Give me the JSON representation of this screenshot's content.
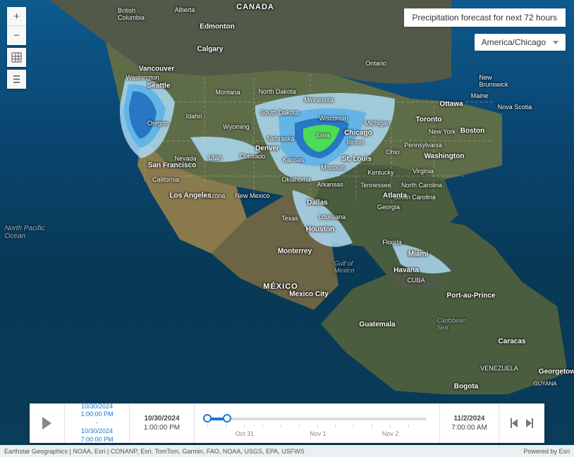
{
  "info_box": "Precipitation forecast for next 72 hours",
  "timezone": "America/Chicago",
  "toolbar": {
    "zoom_in": "+",
    "zoom_out": "−"
  },
  "water_labels": {
    "pacific": "North Pacific\nOcean",
    "gulf": "Gulf of\nMexico",
    "carib": "Caribbean\nSea"
  },
  "countries": {
    "canada": "CANADA",
    "mexico": "MÉXICO",
    "cuba": "CUBA",
    "venezuela": "VENEZUELA",
    "guyana": "GUYANA"
  },
  "labels": {
    "bc": "British\nColumbia",
    "alberta": "Alberta",
    "ontario": "Ontario",
    "brunswick": "New\nBrunswick",
    "novascotia": "Nova Scotia",
    "maine": "Maine",
    "washington": "Washington",
    "montana": "Montana",
    "idaho": "Idaho",
    "oregon": "Oregon",
    "wyoming": "Wyoming",
    "ndakota": "North Dakota",
    "sdakota": "South Dakota",
    "nevada": "Nevada",
    "utah": "Utah",
    "colorado": "Colorado",
    "arizona": "Arizona",
    "nmexico": "New Mexico",
    "california": "California",
    "minnesota": "Minnesota",
    "wisconsin": "Wisconsin",
    "michigan": "Michigan",
    "iowa": "Iowa",
    "nebraska": "Nebraska",
    "illinois": "Illinois",
    "kansas": "Kansas",
    "missouri": "Missouri",
    "oklahoma": "Oklahoma",
    "texas": "Texas",
    "arkansas": "Arkansas",
    "louisiana": "Louisiana",
    "ohio": "Ohio",
    "pennsylvania": "Pennsylvania",
    "newyork": "New York",
    "tennessee": "Tennessee",
    "kentucky": "Kentucky",
    "virginia": "Virginia",
    "ncarolina": "North Carolina",
    "scarolina": "South Carolina",
    "georgia": "Georgia",
    "florida": "Florida"
  },
  "cities": {
    "vancouver": "Vancouver",
    "seattle": "Seattle",
    "calgary": "Calgary",
    "edmonton": "Edmonton",
    "sanfrancisco": "San Francisco",
    "losangeles": "Los Angeles",
    "denver": "Denver",
    "dallas": "Dallas",
    "houston": "Houston",
    "chicago": "Chicago",
    "stlouis": "St. Louis",
    "atlanta": "Atlanta",
    "washingtondc": "Washington",
    "boston": "Boston",
    "toronto": "Toronto",
    "ottawa": "Ottawa",
    "miami": "Miami",
    "havana": "Havana",
    "mexicocity": "Mexico City",
    "monterrey": "Monterrey",
    "guatemala": "Guatemala",
    "bogota": "Bogota",
    "caracas": "Caracas",
    "portauprince": "Port-au-Prince",
    "georgetown": "Georgetown"
  },
  "time_slider": {
    "range_start_date": "10/30/2024",
    "range_start_time": "1:00:00 PM",
    "range_end_date": "10/30/2024",
    "range_end_time": "7:00:00 PM",
    "current_date": "10/30/2024",
    "current_time": "1:00:00 PM",
    "end_date": "11/2/2024",
    "end_time": "7:00:00 AM",
    "tick_labels": [
      "Oct 31",
      "Nov 1",
      "Nov 2"
    ]
  },
  "attribution_left": "Earthstar Geographics | NOAA, Esri | CONANP, Esri, TomTom, Garmin, FAO, NOAA, USGS, EPA, USFWS",
  "attribution_right": "Powered by Esri"
}
